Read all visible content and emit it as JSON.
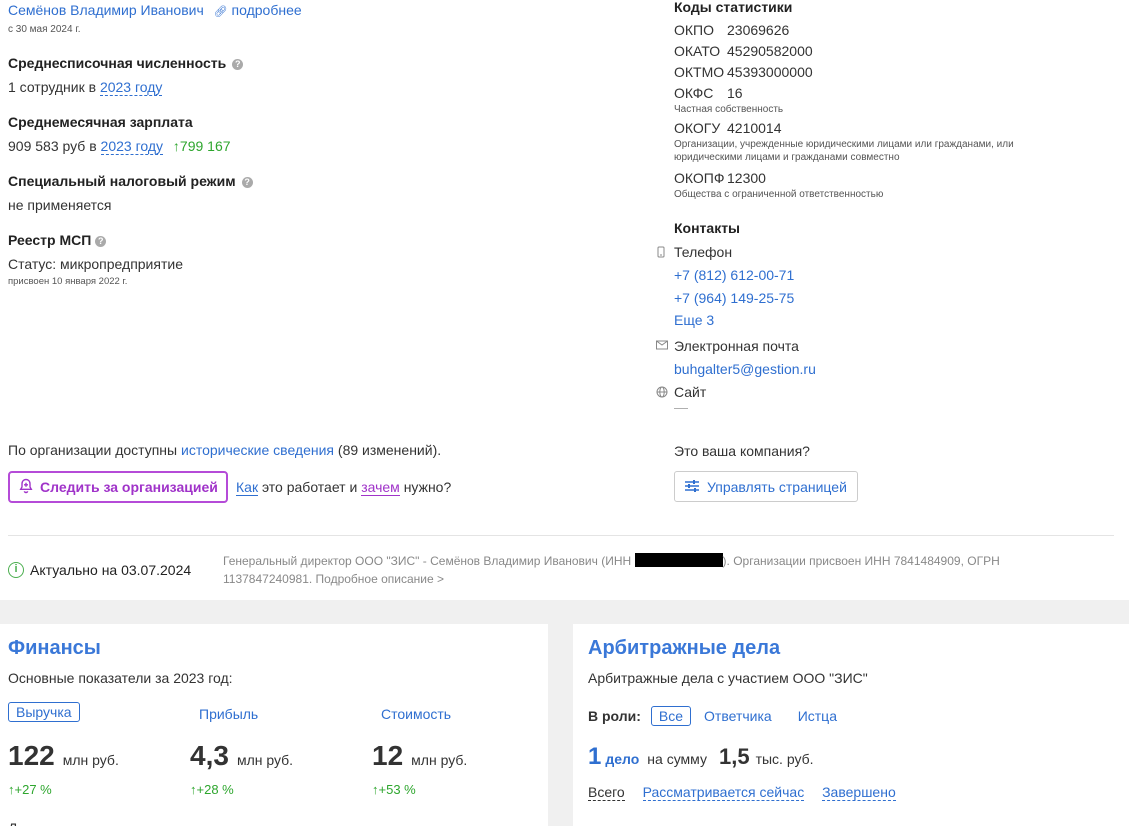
{
  "director": {
    "name": "Семёнов Владимир Иванович",
    "more_label": "подробнее",
    "since": "с 30 мая 2024 г."
  },
  "headcount": {
    "title": "Среднесписочная численность",
    "prefix": "1 сотрудник в",
    "year_link": "2023 году"
  },
  "salary": {
    "title": "Среднемесячная зарплата",
    "prefix": "909 583 руб в",
    "year_link": "2023 году",
    "change": "↑799 167"
  },
  "tax": {
    "title": "Специальный налоговый режим",
    "value": "не применяется"
  },
  "msp": {
    "title": "Реестр МСП",
    "status": "Статус: микропредприятие",
    "assigned": "присвоен 10 января 2022 г."
  },
  "stat_codes": {
    "title": "Коды статистики",
    "okpo": {
      "k": "ОКПО",
      "v": "23069626"
    },
    "okato": {
      "k": "ОКАТО",
      "v": "45290582000"
    },
    "oktmo": {
      "k": "ОКТМО",
      "v": "45393000000"
    },
    "okfs": {
      "k": "ОКФС",
      "v": "16",
      "desc": "Частная собственность"
    },
    "okogu": {
      "k": "ОКОГУ",
      "v": "4210014",
      "desc": "Организации, учрежденные юридическими лицами или гражданами, или юридическими лицами и гражданами совместно"
    },
    "okopf": {
      "k": "ОКОПФ",
      "v": "12300",
      "desc": "Общества с ограниченной ответственностью"
    }
  },
  "contacts": {
    "title": "Контакты",
    "phone_label": "Телефон",
    "phone1": "+7 (812) 612-00-71",
    "phone2": "+7 (964) 149-25-75",
    "more_phones": "Еще 3",
    "email_label": "Электронная почта",
    "email": "buhgalter5@gestion.ru",
    "site_label": "Сайт",
    "site_value": "—"
  },
  "history": {
    "prefix": "По организации доступны",
    "link": "исторические сведения",
    "suffix": "(89 изменений)."
  },
  "follow": {
    "button": "Следить за организацией",
    "how": "Как",
    "mid": "это работает и",
    "why": "зачем",
    "end": "нужно?"
  },
  "company_owner": {
    "question": "Это ваша компания?",
    "manage_button": "Управлять страницей"
  },
  "actual": {
    "label": "Актуально на 03.07.2024",
    "note_before": "Генеральный директор ООО \"ЗИС\" - Семёнов Владимир Иванович (ИНН",
    "note_after": "). Организации присвоен ИНН 7841484909, ОГРН 1137847240981. Подробное описание >"
  },
  "finance": {
    "title": "Финансы",
    "subtitle": "Основные показатели за 2023 год:",
    "tabs": [
      "Выручка",
      "Прибыль",
      "Стоимость"
    ],
    "metrics": [
      {
        "value": "122",
        "unit": "млн руб.",
        "change": "↑+27 %"
      },
      {
        "value": "4,3",
        "unit": "млн руб.",
        "change": "↑+28 %"
      },
      {
        "value": "12",
        "unit": "млн руб.",
        "change": "↑+53 %"
      }
    ],
    "cut_text": "Д"
  },
  "arbitration": {
    "title": "Арбитражные дела",
    "subtitle": "Арбитражные дела с участием ООО \"ЗИС\"",
    "roles_label": "В роли:",
    "roles": [
      "Все",
      "Ответчика",
      "Истца"
    ],
    "count": "1",
    "count_unit": "дело",
    "sum_label": "на сумму",
    "sum": "1,5",
    "sum_unit": "тыс. руб.",
    "filters": [
      "Всего",
      "Рассматривается сейчас",
      "Завершено"
    ]
  },
  "colors": {
    "link": "#2f6fd0",
    "accent_purple": "#a033c9",
    "green": "#2ea62e",
    "title_blue": "#3a78d8"
  }
}
